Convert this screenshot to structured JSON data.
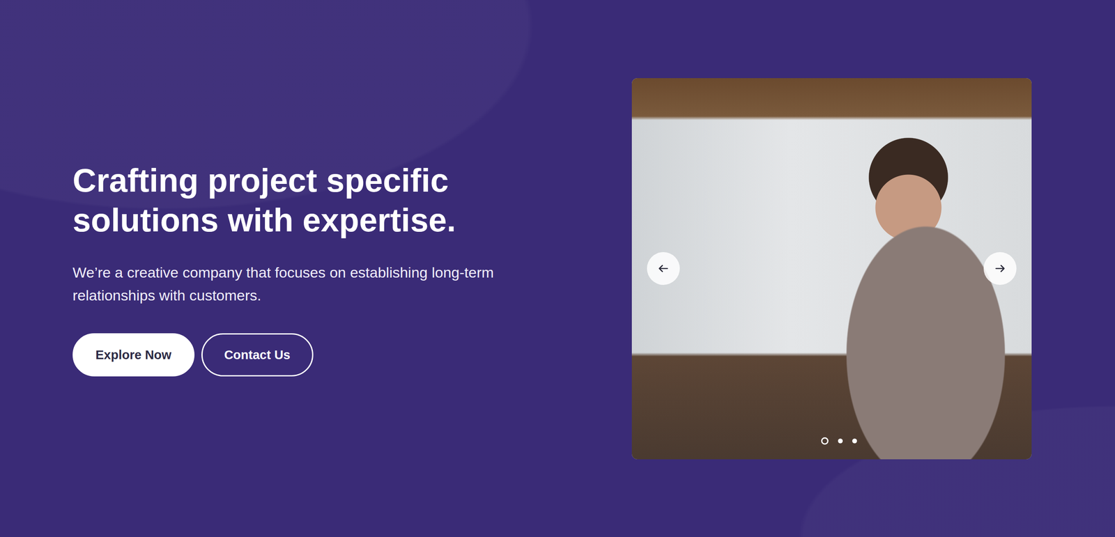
{
  "hero": {
    "heading": "Crafting project specific solutions with expertise.",
    "text": "We’re a creative company that focuses on establishing long-term relationships with customers.",
    "buttons": [
      {
        "label": "Explore Now",
        "kind": "solid"
      },
      {
        "label": "Contact Us",
        "kind": "outline"
      }
    ]
  },
  "carousel": {
    "slides": [
      {
        "selected": true
      },
      {
        "selected": false
      },
      {
        "selected": false
      }
    ]
  }
}
